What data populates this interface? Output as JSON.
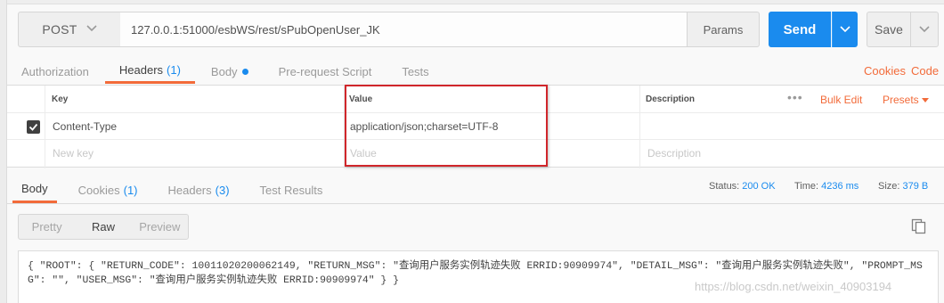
{
  "request": {
    "method": "POST",
    "url": "127.0.0.1:51000/esbWS/rest/sPubOpenUser_JK",
    "params_label": "Params",
    "send_label": "Send",
    "save_label": "Save"
  },
  "request_tabs": [
    {
      "label": "Authorization"
    },
    {
      "label": "Headers",
      "count": "(1)",
      "active": true
    },
    {
      "label": "Body"
    },
    {
      "label": "Pre-request Script"
    },
    {
      "label": "Tests"
    }
  ],
  "links": {
    "cookies": "Cookies",
    "code": "Code"
  },
  "headers_table": {
    "columns": {
      "key": "Key",
      "value": "Value",
      "description": "Description"
    },
    "bulk_edit": "Bulk Edit",
    "presets": "Presets",
    "rows": [
      {
        "checked": true,
        "key": "Content-Type",
        "value": "application/json;charset=UTF-8",
        "description": ""
      }
    ],
    "placeholders": {
      "key": "New key",
      "value": "Value",
      "description": "Description"
    }
  },
  "response_tabs": [
    {
      "label": "Body",
      "active": true
    },
    {
      "label": "Cookies",
      "count": "(1)"
    },
    {
      "label": "Headers",
      "count": "(3)"
    },
    {
      "label": "Test Results"
    }
  ],
  "response_status": {
    "status_label": "Status:",
    "status_value": "200 OK",
    "time_label": "Time:",
    "time_value": "4236 ms",
    "size_label": "Size:",
    "size_value": "379 B"
  },
  "view_modes": [
    {
      "label": "Pretty"
    },
    {
      "label": "Raw",
      "active": true
    },
    {
      "label": "Preview"
    }
  ],
  "response_body": "{ \"ROOT\": { \"RETURN_CODE\": 10011020200062149, \"RETURN_MSG\": \"查询用户服务实例轨迹失败 ERRID:90909974\", \"DETAIL_MSG\": \"查询用户服务实例轨迹失败\", \"PROMPT_MSG\": \"\", \"USER_MSG\": \"查询用户服务实例轨迹失败 ERRID:90909974\" } }",
  "watermark": "https://blog.csdn.net/weixin_40903194",
  "colors": {
    "accent": "#f26b3a",
    "send": "#1a8bee",
    "highlight_box": "#d0262b"
  },
  "icons": [
    "chevron-down-icon",
    "checkbox-checked-icon",
    "more-dots-icon",
    "caret-down-icon",
    "copy-icon"
  ]
}
